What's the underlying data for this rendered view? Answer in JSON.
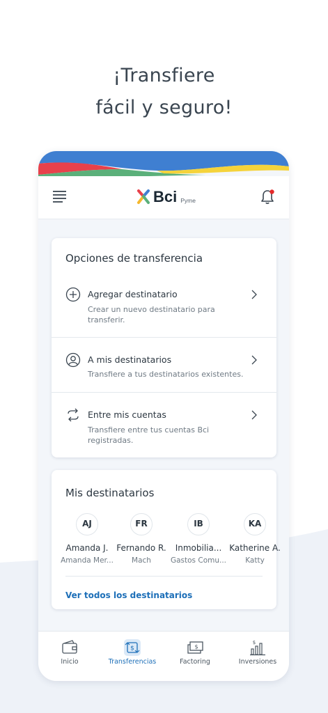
{
  "headline": {
    "line1": "¡Transfiere",
    "line2": "fácil y seguro!"
  },
  "app": {
    "logo_text": "Bci",
    "logo_sub": "Pyme",
    "icons": {
      "menu": "hamburger-icon",
      "notifications": "bell-icon"
    },
    "colors": {
      "accent": "#1d6fb8",
      "badge": "#e52a2a",
      "wave_blue": "#3f7fd1",
      "wave_red": "#e8414b",
      "wave_green": "#5bb07a",
      "wave_yellow": "#f5d33b"
    }
  },
  "transfer_options": {
    "title": "Opciones de transferencia",
    "items": [
      {
        "label": "Agregar destinatario",
        "description": "Crear un nuevo destinatario para transferir.",
        "icon": "plus-circle-icon"
      },
      {
        "label": "A mis destinatarios",
        "description": "Transfiere a tus destinatarios existentes.",
        "icon": "user-circle-icon"
      },
      {
        "label": "Entre mis cuentas",
        "description": "Transfiere entre tus cuentas Bci registradas.",
        "icon": "swap-arrows-icon"
      }
    ]
  },
  "recipients": {
    "title": "Mis destinatarios",
    "items": [
      {
        "initials": "AJ",
        "name": "Amanda J.",
        "sub": "Amanda Mer..."
      },
      {
        "initials": "FR",
        "name": "Fernando R.",
        "sub": "Mach"
      },
      {
        "initials": "IB",
        "name": "Inmobilia...",
        "sub": "Gastos Comu..."
      },
      {
        "initials": "KA",
        "name": "Katherine A.",
        "sub": "Katty"
      }
    ],
    "see_all": "Ver todos los destinatarios"
  },
  "tabs": [
    {
      "label": "Inicio",
      "icon": "wallet-icon",
      "active": false
    },
    {
      "label": "Transferencias",
      "icon": "transfer-money-icon",
      "active": true
    },
    {
      "label": "Factoring",
      "icon": "bills-icon",
      "active": false
    },
    {
      "label": "Inversiones",
      "icon": "bar-chart-icon",
      "active": false
    }
  ]
}
